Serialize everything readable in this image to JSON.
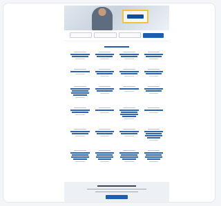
{
  "colors": {
    "accent": "#1a5fb4",
    "link": "#2a62b0",
    "brand_yellow": "#f2c230",
    "background": "#f3f5f9",
    "footer_bg": "#edf0f4"
  },
  "header": {
    "brand_icon": "company-logo-icon"
  },
  "search": {
    "what_placeholder": "",
    "category_value": "",
    "location_value": "",
    "submit_label": ""
  },
  "section": {
    "title": ""
  },
  "listings": [
    {
      "category": "",
      "title": "",
      "meta": "",
      "size": "normal"
    },
    {
      "category": "",
      "title": "",
      "meta": "",
      "size": "normal"
    },
    {
      "category": "",
      "title": "",
      "meta": "",
      "size": "normal"
    },
    {
      "category": "",
      "title": "",
      "meta": "",
      "size": "normal"
    },
    {
      "category": "",
      "title": "",
      "meta": "",
      "size": "short"
    },
    {
      "category": "",
      "title": "",
      "meta": "",
      "size": "normal"
    },
    {
      "category": "",
      "title": "",
      "meta": "",
      "size": "normal"
    },
    {
      "category": "",
      "title": "",
      "meta": "",
      "size": "normal"
    },
    {
      "category": "",
      "title": "",
      "meta": "",
      "size": "tall"
    },
    {
      "category": "",
      "title": "",
      "meta": "",
      "size": "normal"
    },
    {
      "category": "",
      "title": "",
      "meta": "",
      "size": "short"
    },
    {
      "category": "",
      "title": "",
      "meta": "",
      "size": "normal"
    },
    {
      "category": "",
      "title": "",
      "meta": "",
      "size": "normal"
    },
    {
      "category": "",
      "title": "",
      "meta": "",
      "size": "short"
    },
    {
      "category": "",
      "title": "",
      "meta": "",
      "size": "tall"
    },
    {
      "category": "",
      "title": "",
      "meta": "",
      "size": "short"
    },
    {
      "category": "",
      "title": "",
      "meta": "",
      "size": "normal"
    },
    {
      "category": "",
      "title": "",
      "meta": "",
      "size": "normal"
    },
    {
      "category": "",
      "title": "",
      "meta": "",
      "size": "normal"
    },
    {
      "category": "",
      "title": "",
      "meta": "",
      "size": "tall"
    },
    {
      "category": "",
      "title": "",
      "meta": "",
      "size": "tall"
    },
    {
      "category": "",
      "title": "",
      "meta": "",
      "size": "tall"
    },
    {
      "category": "",
      "title": "",
      "meta": "",
      "size": "tall"
    },
    {
      "category": "",
      "title": "",
      "meta": "",
      "size": "tall"
    }
  ],
  "footer": {
    "title": "",
    "text_line_1": "",
    "text_line_2": "",
    "cta_label": ""
  }
}
